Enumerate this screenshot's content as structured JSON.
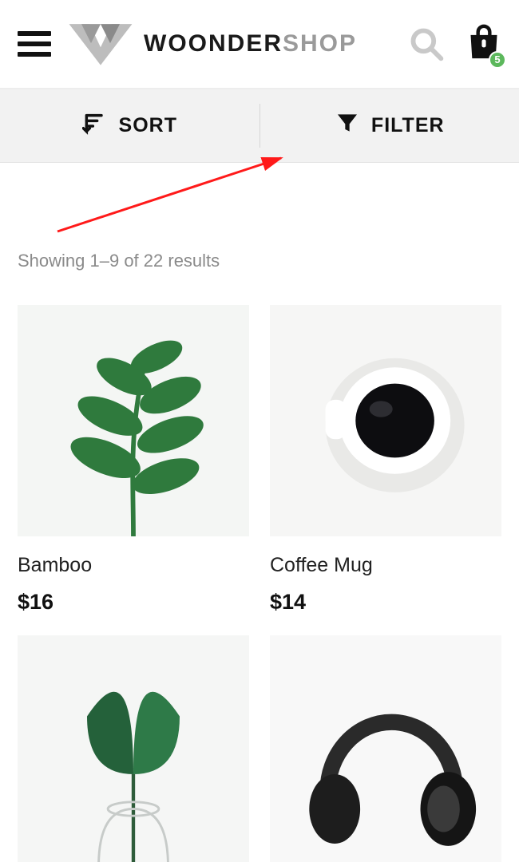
{
  "header": {
    "brand_first": "WOONDER",
    "brand_second": "SHOP",
    "cart_count": "5"
  },
  "toolbar": {
    "sort_label": "SORT",
    "filter_label": "FILTER"
  },
  "listing": {
    "results_text": "Showing 1–9 of 22 results"
  },
  "products": [
    {
      "name": "Bamboo",
      "price": "$16"
    },
    {
      "name": "Coffee Mug",
      "price": "$14"
    },
    {
      "name": "",
      "price": ""
    },
    {
      "name": "",
      "price": ""
    }
  ]
}
